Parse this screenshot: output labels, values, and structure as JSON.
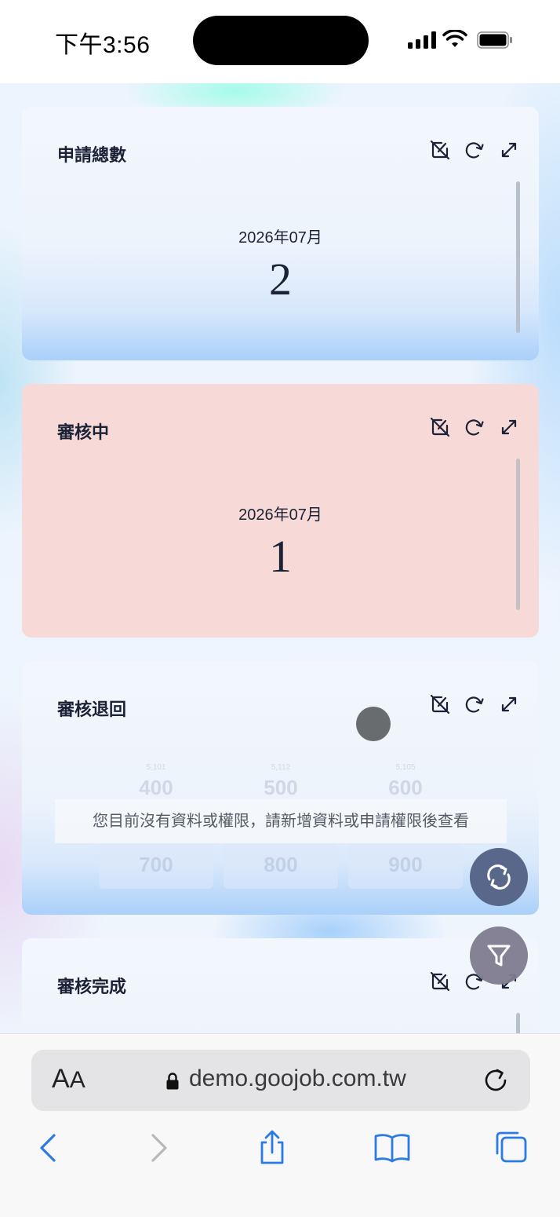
{
  "status_bar": {
    "time": "下午3:56"
  },
  "cards": [
    {
      "title": "申請總數",
      "period": "2026年07月",
      "value": "2"
    },
    {
      "title": "審核中",
      "period": "2026年07月",
      "value": "1"
    },
    {
      "title": "審核退回",
      "empty_message": "您目前沒有資料或權限，請新增資料或申請權限後查看",
      "placeholder_numbers": [
        "400",
        "500",
        "600",
        "700",
        "800",
        "900"
      ],
      "placeholder_small": [
        "5,101",
        "5,112",
        "5,105"
      ]
    },
    {
      "title": "審核完成"
    }
  ],
  "icons": {
    "tool_icons": [
      "edit-off-icon",
      "refresh-icon",
      "expand-icon"
    ],
    "fab_icons": [
      "sync-icon",
      "filter-icon"
    ]
  },
  "browser": {
    "aa_label_big": "A",
    "aa_label_small": "A",
    "url": "demo.goojob.com.tw"
  },
  "colors": {
    "card_pink": "#f7dad8",
    "card_blue_bottom": "#aad0fa",
    "fab_refresh": "#58678a",
    "fab_filter": "#7f7c8f",
    "safari_blue": "#2c7be5"
  }
}
